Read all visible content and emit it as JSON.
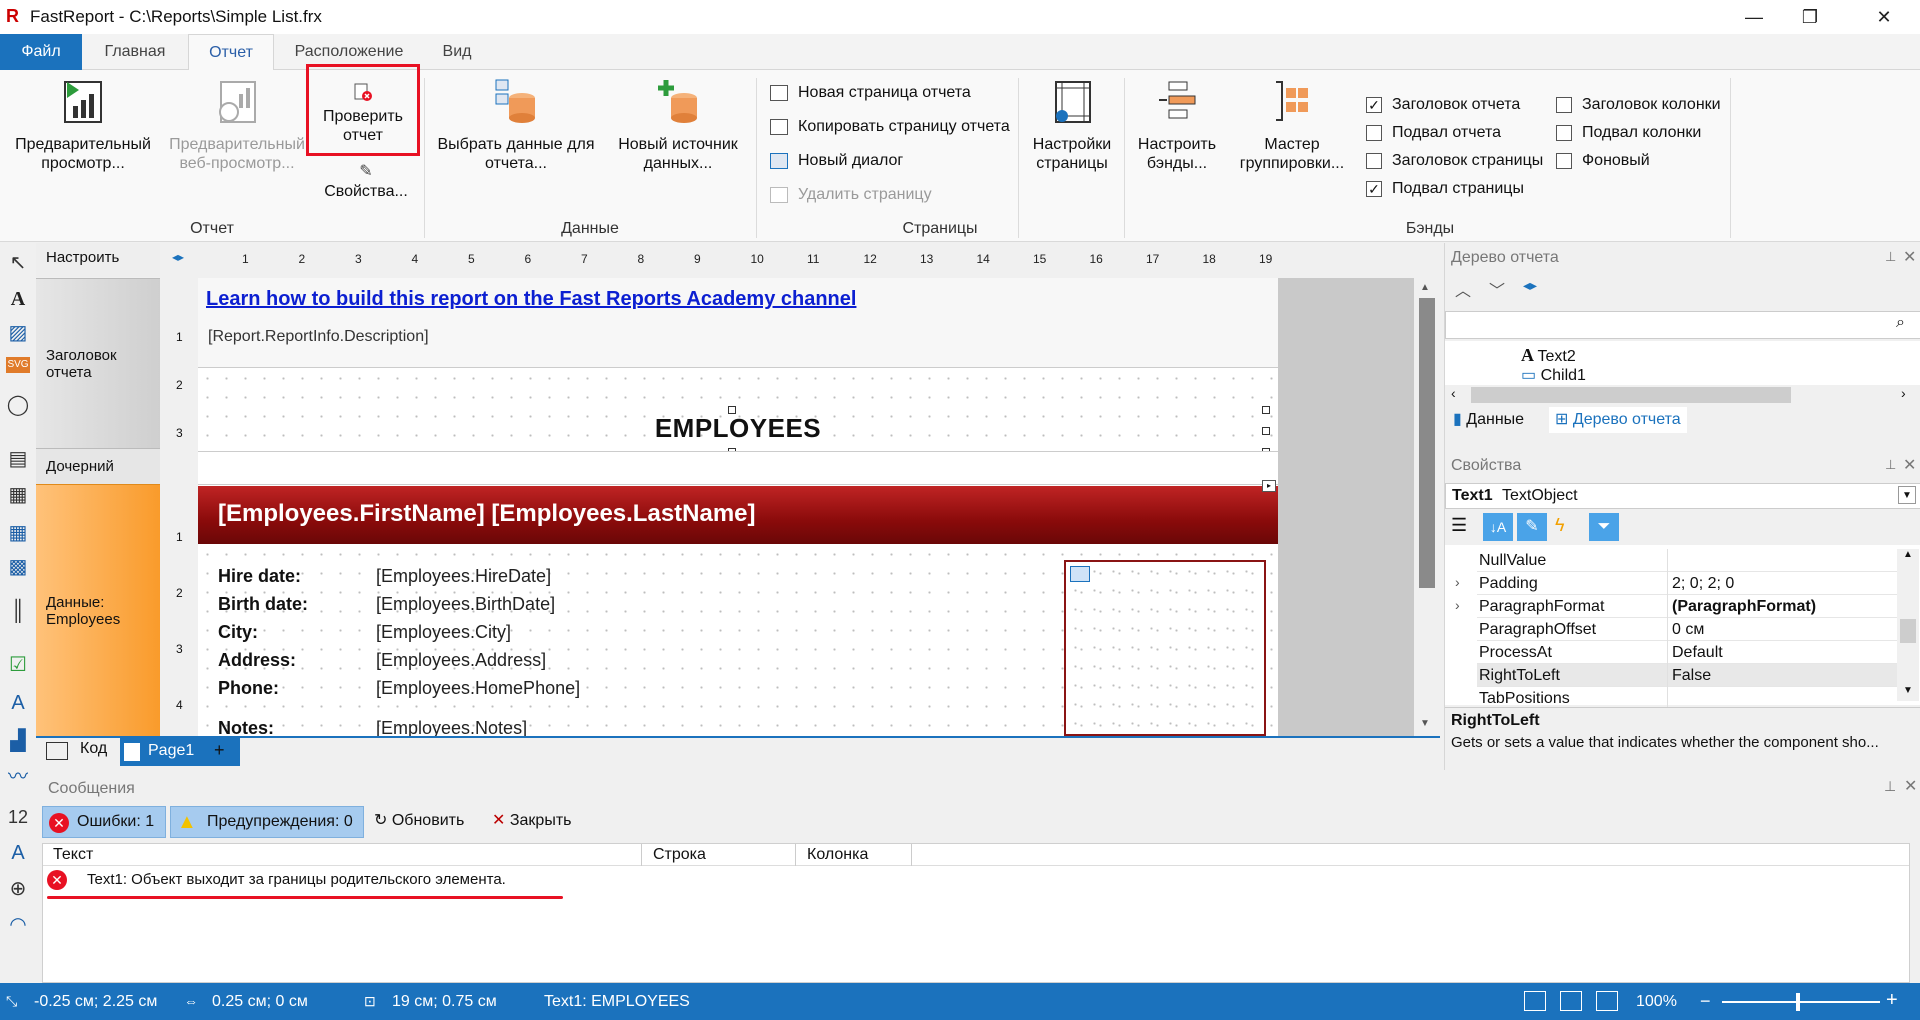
{
  "window": {
    "app_title": "FastReport - C:\\Reports\\Simple List.frx",
    "min": "—",
    "max": "❐",
    "close": "✕"
  },
  "tabs": [
    "Файл",
    "Главная",
    "Отчет",
    "Расположение",
    "Вид"
  ],
  "ribbon": {
    "preview": "Предварительный просмотр...",
    "web_preview": "Предварительный веб-просмотр...",
    "check": "Проверить отчет",
    "props": "Свойства...",
    "select_data": "Выбрать данные для отчета...",
    "new_source": "Новый источник данных...",
    "new_page": "Новая страница отчета",
    "copy_page": "Копировать страницу отчета",
    "new_dialog": "Новый диалог",
    "delete_page": "Удалить страницу",
    "page_settings": "Настройки страницы",
    "config_bands": "Настроить бэнды...",
    "group_master": "Мастер группировки...",
    "chk_report_title": "Заголовок отчета",
    "chk_report_summary": "Подвал отчета",
    "chk_page_header": "Заголовок страницы",
    "chk_page_footer": "Подвал страницы",
    "chk_column_header": "Заголовок колонки",
    "chk_column_footer": "Подвал колонки",
    "chk_overlay": "Фоновый",
    "group_report": "Отчет",
    "group_data": "Данные",
    "group_pages": "Страницы",
    "group_bands": "Бэнды",
    "checked": {
      "report_title": true,
      "report_summary": false,
      "page_header": false,
      "page_footer": true,
      "column_header": false,
      "column_footer": false,
      "overlay": false
    }
  },
  "designer": {
    "configure": "Настроить",
    "band_title": "Заголовок отчета",
    "band_child": "Дочерний",
    "band_data": "Данные: Employees",
    "ruler": [
      "1",
      "2",
      "3",
      "4",
      "5",
      "6",
      "7",
      "8",
      "9",
      "10",
      "11",
      "12",
      "13",
      "14",
      "15",
      "16",
      "17",
      "18",
      "19"
    ],
    "vruler1": [
      "1",
      "2",
      "3"
    ],
    "vruler2": [
      "1",
      "2",
      "3",
      "4"
    ],
    "link": "Learn how to build this report on the Fast Reports Academy channel",
    "description": "[Report.ReportInfo.Description]",
    "title": "EMPLOYEES",
    "name_band": "[Employees.FirstName] [Employees.LastName]",
    "fields": [
      {
        "label": "Hire date:",
        "value": "[Employees.HireDate]"
      },
      {
        "label": "Birth date:",
        "value": "[Employees.BirthDate]"
      },
      {
        "label": "City:",
        "value": "[Employees.City]"
      },
      {
        "label": "Address:",
        "value": "[Employees.Address]"
      },
      {
        "label": "Phone:",
        "value": "[Employees.HomePhone]"
      },
      {
        "label": "Notes:",
        "value": "[Employees.Notes]"
      }
    ],
    "tab_code": "Код",
    "tab_page1": "Page1",
    "tab_add": "+"
  },
  "messages": {
    "title": "Сообщения",
    "errors": "Ошибки: 1",
    "warnings": "Предупреждения: 0",
    "refresh": "Обновить",
    "close": "Закрыть",
    "col_text": "Текст",
    "col_line": "Строка",
    "col_column": "Колонка",
    "row": "Text1: Объект выходит за границы родительского элемента."
  },
  "tree": {
    "title": "Дерево отчета",
    "items": [
      "Text2",
      "Child1"
    ],
    "tab_data": "Данные",
    "tab_tree": "Дерево отчета"
  },
  "props": {
    "title": "Свойства",
    "object_name": "Text1",
    "object_type": "TextObject",
    "rows": [
      {
        "name": "NullValue",
        "value": "",
        "expand": false
      },
      {
        "name": "Padding",
        "value": "2; 0; 2; 0",
        "expand": true
      },
      {
        "name": "ParagraphFormat",
        "value": "(ParagraphFormat)",
        "expand": true
      },
      {
        "name": "ParagraphOffset",
        "value": "0 см",
        "expand": false
      },
      {
        "name": "ProcessAt",
        "value": "Default",
        "expand": false
      },
      {
        "name": "RightToLeft",
        "value": "False",
        "expand": false
      },
      {
        "name": "TabPositions",
        "value": "",
        "expand": false
      }
    ],
    "help_title": "RightToLeft",
    "help_text": "Gets or sets a value that indicates whether the component sho..."
  },
  "status": {
    "pos": "-0.25 см; 2.25 см",
    "offset": "0.25 см; 0 см",
    "size": "19 см; 0.75 см",
    "selected": "Text1:  EMPLOYEES",
    "zoom": "100%"
  },
  "colors": {
    "accent": "#1b72bd",
    "band_red": "#8a0b0b",
    "highlight": "#e81123"
  }
}
